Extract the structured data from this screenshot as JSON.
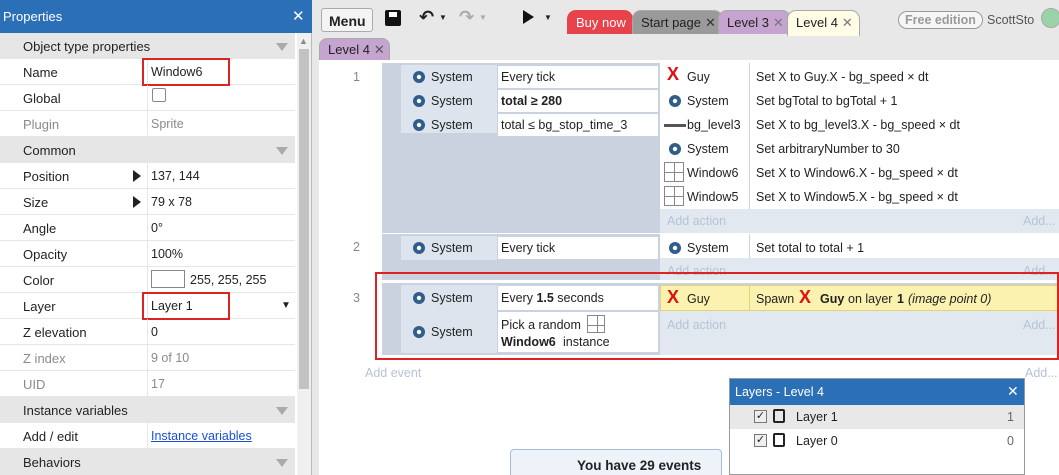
{
  "properties": {
    "title": "Properties",
    "rows": [
      {
        "k": "Object type properties",
        "sec": true
      },
      {
        "k": "Name",
        "v": "Window6"
      },
      {
        "k": "Global",
        "v": ""
      },
      {
        "k": "Plugin",
        "v": "Sprite",
        "dis": true
      },
      {
        "k": "Common",
        "sec": true
      },
      {
        "k": "Position",
        "v": "137, 144",
        "tri": true
      },
      {
        "k": "Size",
        "v": "79 x 78",
        "tri": true
      },
      {
        "k": "Angle",
        "v": "0°"
      },
      {
        "k": "Opacity",
        "v": "100%"
      },
      {
        "k": "Color",
        "v": "255, 255, 255"
      },
      {
        "k": "Layer",
        "v": "Layer 1"
      },
      {
        "k": "Z elevation",
        "v": "0"
      },
      {
        "k": "Z index",
        "v": "9 of 10",
        "dis": true
      },
      {
        "k": "UID",
        "v": "17",
        "dis": true
      },
      {
        "k": "Instance variables",
        "sec": true
      },
      {
        "k": "Add / edit",
        "v": "Instance variables",
        "link": true
      },
      {
        "k": "Behaviors",
        "sec": true
      }
    ]
  },
  "toolbar": {
    "menu": "Menu",
    "tabs": [
      "Buy now",
      "Start page",
      "Level 3",
      "Level 4"
    ],
    "second_tab": "Level 4",
    "free": "Free edition",
    "user": "ScottSto"
  },
  "events": {
    "e1": {
      "num": "1",
      "c1": "Every tick",
      "c2": "total ≥ 280",
      "c3": "total ≤ bg_stop_time_3",
      "a1": "Set X to Guy.X - bg_speed × dt",
      "a2": "Set bgTotal to bgTotal + 1",
      "a3": "Set X to bg_level3.X - bg_speed × dt",
      "a4": "Set arbitraryNumber to 30",
      "a5": "Set X to Window6.X - bg_speed × dt",
      "a6": "Set X to Window5.X - bg_speed × dt"
    },
    "e2": {
      "num": "2",
      "c1": "Every tick",
      "a1": "Set total to total + 1"
    },
    "e3": {
      "num": "3",
      "c1": "Every 1.5 seconds",
      "c2a": "Pick a random",
      "c2b": "Window6 instance",
      "a1pre": "Spawn",
      "a1obj": "Guy",
      "a1mid": "on layer",
      "a1num": "1",
      "a1suf": "(image point 0)"
    },
    "objects": {
      "system": "System",
      "guy": "Guy",
      "bg": "bg_level3",
      "w6": "Window6",
      "w5": "Window5"
    },
    "add_action": "Add action",
    "add_event": "Add event",
    "add_short": "Add..."
  },
  "layers": {
    "title": "Layers - Level 4",
    "items": [
      {
        "name": "Layer 1",
        "idx": "1"
      },
      {
        "name": "Layer 0",
        "idx": "0"
      }
    ]
  },
  "notice": "You have 29 events"
}
